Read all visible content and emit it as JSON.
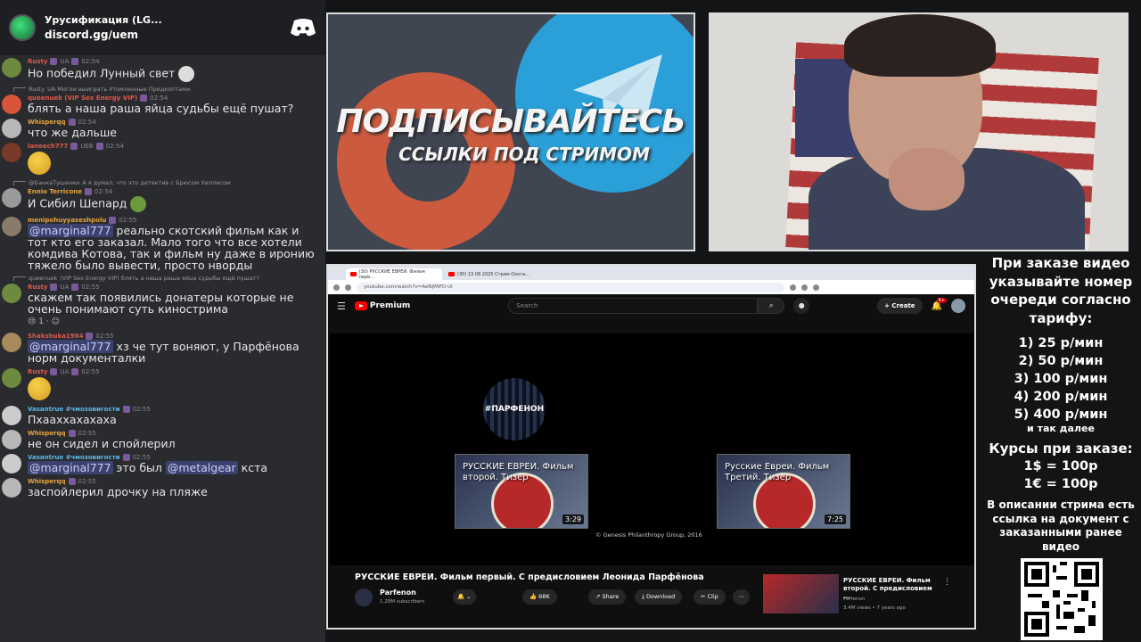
{
  "server": {
    "name": "Урусификация (LG...",
    "link": "discord.gg/uem"
  },
  "chat": [
    {
      "user": "Rusty",
      "user_color": "#e0584a",
      "tags": "UA",
      "time": "02:54",
      "text": "Но победил Лунный свет",
      "avatar_color": "#6e8a3e"
    },
    {
      "reply_user": "Rusty",
      "reply_text": "UA Могли выиграть Утомленные Предкоптами",
      "user": "queenuek (VIP Sex Energy VIP)",
      "user_color": "#e0584a",
      "time": "02:54",
      "text": "блять а наша раша яйца судьбы ещё пушат?",
      "avatar_color": "#d8553a"
    },
    {
      "user": "Whisperqq",
      "user_color": "#e8a33a",
      "time": "02:54",
      "text": "что же дальше",
      "avatar_color": "#b8b8b8"
    },
    {
      "user": "laneech777",
      "user_color": "#e0584a",
      "tags": "UEB",
      "time": "02:54",
      "text": "",
      "avatar_color": "#7a3a2a"
    },
    {
      "reply_user": "@БанкаТушенки",
      "reply_text": "А я думал, что это детектив с Брюсом Уиллисом",
      "user": "Ennio Terricone",
      "user_color": "#e8a33a",
      "time": "02:54",
      "text": "И Сибил Шепард",
      "avatar_color": "#9a9a9a"
    },
    {
      "user": "menipohuyyaseshpolu",
      "user_color": "#e8a33a",
      "time": "02:55",
      "mention": "@marginal777",
      "text": " реально скотский фильм как и тот кто его заказал. Мало того что все хотели комдива Котова, так и фильм ну даже в иронию тяжело было вывести, просто нворды",
      "avatar_color": "#8a7a6a"
    },
    {
      "reply_user": "queenuek",
      "reply_text": "(VIP Sex Energy VIP) блять а наша раша яйца судьбы ещё пушат?",
      "user": "Rusty",
      "user_color": "#e0584a",
      "tags": "UA",
      "time": "02:55",
      "text": "скажем так появились донатеры которые не очень понимают суть киностримa",
      "reaction": "1",
      "avatar_color": "#6e8a3e"
    },
    {
      "user": "Shakshuka1984",
      "user_color": "#e0584a",
      "time": "02:55",
      "mention": "@marginal777",
      "text": " хз че тут воняют, у Парфёнова норм документалки",
      "avatar_color": "#a88a5a"
    },
    {
      "user": "Rusty",
      "user_color": "#e0584a",
      "tags": "UA",
      "time": "02:55",
      "text": "",
      "avatar_color": "#6e8a3e"
    },
    {
      "user": "Vasantrue #чмозовигости",
      "user_color": "#5ab8e8",
      "time": "02:55",
      "text": "Пхааххахахаха",
      "avatar_color": "#cccccc"
    },
    {
      "user": "Whisperqq",
      "user_color": "#e8a33a",
      "time": "02:55",
      "text": "не он сидел и спойлерил",
      "avatar_color": "#b8b8b8"
    },
    {
      "user": "Vasantrue #чмозовигости",
      "user_color": "#5ab8e8",
      "time": "02:55",
      "mention": "@marginal777",
      "text": " это был ",
      "mention2": "@metalgear",
      "text2": " кста",
      "avatar_color": "#cccccc"
    },
    {
      "user": "Whisperqq",
      "user_color": "#e8a33a",
      "time": "02:55",
      "text": "заспойлерил дрочку на пляже",
      "avatar_color": "#b8b8b8"
    }
  ],
  "promo": {
    "title": "ПОДПИСЫВАЙТЕСЬ",
    "subtitle": "ССЫЛКИ ПОД СТРИМОМ"
  },
  "browser": {
    "tabs": [
      "(30) РУССКИЕ ЕВРЕИ. Фильм перв...",
      "(30) 13 08 2025 Стрим Охота..."
    ],
    "url": "youtube.com/watch?v=AeNjPAFD-UI",
    "search_placeholder": "Search",
    "create_label": "Create",
    "notif_count": "9+",
    "logo_text": "Premium",
    "channel_logo_text": "#ПАРФЕНОН",
    "endcards": [
      {
        "title": "РУССКИЕ ЕВРЕИ. Фильм второй. Тизер",
        "duration": "3:29"
      },
      {
        "title": "Русские Евреи. Фильм Третий. Тизер",
        "duration": "7:25"
      }
    ],
    "copyright": "© Genesis Philanthropy Group, 2016",
    "video_title": "РУССКИЕ ЕВРЕИ. Фильм первый. С предисловием Леонида Парфёнова",
    "channel": "Parfenon",
    "subscribers": "1.29M subscribers",
    "likes": "68K",
    "share_label": "Share",
    "download_label": "Download",
    "clip_label": "Clip",
    "side_video": {
      "title": "РУССКИЕ ЕВРЕИ. Фильм второй. С предисловием ...",
      "channel": "Parfenon",
      "stats": "3.4M views • 7 years ago"
    }
  },
  "info": {
    "head": "При заказе видео указывайте номер очереди согласно тарифу:",
    "tariffs": [
      "1) 25 р/мин",
      "2) 50 р/мин",
      "3) 100 р/мин",
      "4) 200 р/мин",
      "5) 400 р/мин"
    ],
    "tariff_more": "и так далее",
    "rates_head": "Курсы при заказе:",
    "rates": [
      "1$ = 100р",
      "1€ = 100р"
    ],
    "note": "В описании стрима есть ссылка на документ с заказанными ранее видео"
  }
}
